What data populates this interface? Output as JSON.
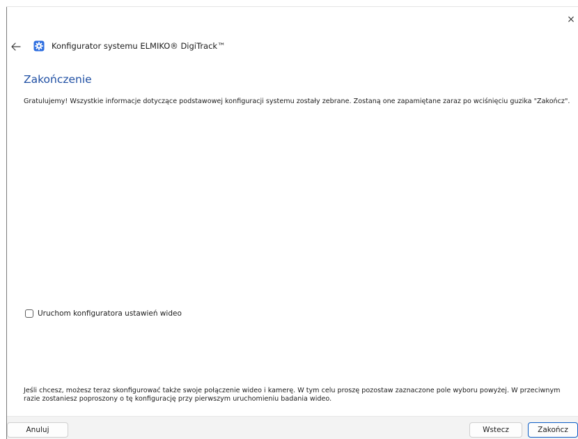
{
  "window": {
    "close_glyph": "×"
  },
  "header": {
    "back_icon": "arrow-left-icon",
    "app_icon": "gear-badge-icon",
    "app_icon_color": "#2f6fe0",
    "title": "Konfigurator systemu ELMIKO® DigiTrack™"
  },
  "main": {
    "heading": "Zakończenie",
    "heading_color": "#1f4fa3",
    "intro": "Gratulujemy! Wszystkie informacje dotyczące podstawowej konfiguracji systemu zostały zebrane. Zostaną one zapamiętane zaraz po wciśnięciu guzika \"Zakończ\".",
    "video_checkbox": {
      "label": "Uruchom konfiguratora ustawień wideo",
      "checked": false
    },
    "note": "Jeśli chcesz, możesz teraz skonfigurować także swoje połączenie wideo i kamerę. W tym celu proszę pozostaw zaznaczone pole wyboru powyżej. W przeciwnym razie zostaniesz poproszony o tę konfigurację przy pierwszym uruchomieniu badania wideo."
  },
  "footer": {
    "cancel_label": "Anuluj",
    "back_label": "Wstecz",
    "finish_label": "Zakończ",
    "finish_border_color": "#0a5bc4"
  }
}
